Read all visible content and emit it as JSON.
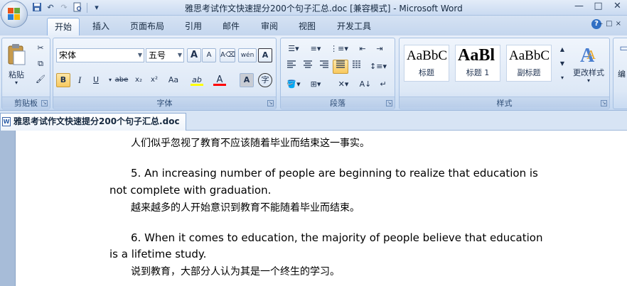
{
  "window": {
    "title": "雅思考试作文快速提分200个句子汇总.doc [兼容模式] - Microsoft Word",
    "controls": [
      "—",
      "□",
      "✕"
    ]
  },
  "tabs": [
    {
      "label": "开始",
      "active": true
    },
    {
      "label": "插入"
    },
    {
      "label": "页面布局"
    },
    {
      "label": "引用"
    },
    {
      "label": "邮件"
    },
    {
      "label": "审阅"
    },
    {
      "label": "视图"
    },
    {
      "label": "开发工具"
    }
  ],
  "help_icon": "?",
  "clipboard": {
    "label": "剪贴板",
    "paste_label": "粘贴"
  },
  "font": {
    "label": "字体",
    "font_name": "宋体",
    "font_size": "五号",
    "grow": "A",
    "shrink": "A",
    "phonetic": "wén",
    "border_char": "A",
    "bold": "B",
    "italic": "I",
    "underline": "U",
    "strike": "abe",
    "subscript": "x₂",
    "superscript": "x²",
    "change_case": "Aa",
    "highlight": "ab",
    "font_color": "A",
    "char_shading": "A",
    "enclose": "字"
  },
  "paragraph": {
    "label": "段落"
  },
  "styles": {
    "label": "样式",
    "items": [
      {
        "sample": "AaBbC",
        "name": "标题"
      },
      {
        "sample": "AaBl",
        "name": "标题 1"
      },
      {
        "sample": "AaBbC",
        "name": "副标题"
      }
    ],
    "change_styles_label": "更改样式"
  },
  "editing": {
    "label": "编"
  },
  "document": {
    "tab_title": "雅思考试作文快速提分200个句子汇总.doc",
    "lines": [
      "人们似乎忽视了教育不应该随着毕业而结束这一事实。",
      "5. An increasing number of people are beginning to realize that education is",
      "not complete  with  graduation.",
      "越来越多的人开始意识到教育不能随着毕业而结束。",
      "6. When it comes to education, the majority of people believe that education",
      "is a lifetime  study.",
      "说到教育，大部分人认为其是一个终生的学习。"
    ]
  },
  "colors": {
    "ribbon": "#dbe7f6",
    "highlight_yellow": "#ffff00",
    "font_red": "#ff0000"
  }
}
